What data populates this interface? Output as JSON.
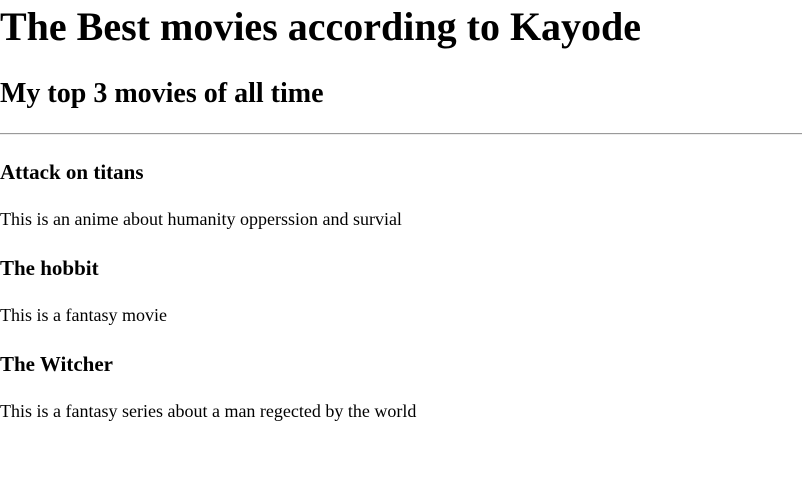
{
  "page": {
    "title": "The Best movies according to Kayode",
    "subtitle": "My top 3 movies of all time"
  },
  "movies": [
    {
      "title": "Attack on titans",
      "description": "This is an anime about humanity opperssion and survial"
    },
    {
      "title": "The hobbit",
      "description": "This is a fantasy movie"
    },
    {
      "title": "The Witcher",
      "description": "This is a fantasy series about a man regected by the world"
    }
  ]
}
